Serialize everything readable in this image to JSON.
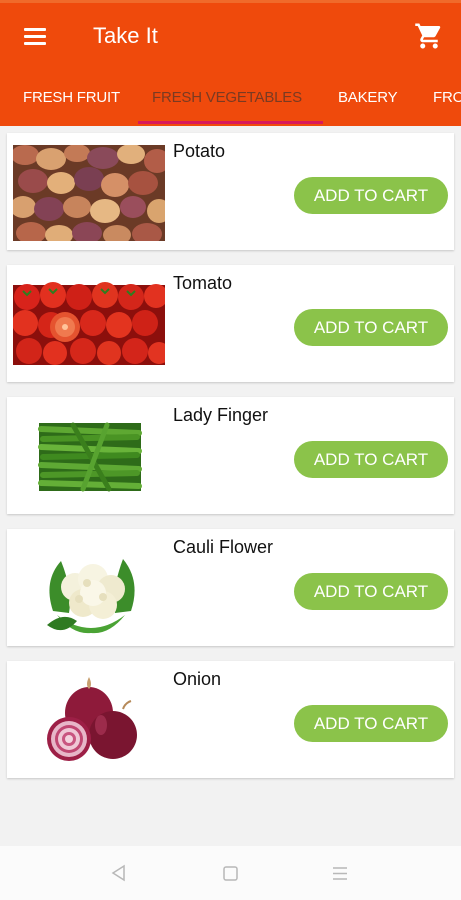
{
  "app": {
    "title": "Take It"
  },
  "tabs": [
    {
      "label": "FRESH FRUIT",
      "active": false
    },
    {
      "label": "FRESH VEGETABLES",
      "active": true
    },
    {
      "label": "BAKERY",
      "active": false
    },
    {
      "label": "FRO",
      "active": false
    }
  ],
  "products": [
    {
      "name": "Potato",
      "button": "ADD TO CART",
      "image": "potato-image"
    },
    {
      "name": "Tomato",
      "button": "ADD TO CART",
      "image": "tomato-image"
    },
    {
      "name": "Lady Finger",
      "button": "ADD TO CART",
      "image": "lady-finger-image"
    },
    {
      "name": "Cauli Flower",
      "button": "ADD TO CART",
      "image": "cauliflower-image"
    },
    {
      "name": "Onion",
      "button": "ADD TO CART",
      "image": "onion-image"
    }
  ],
  "icons": {
    "menu": "menu-icon",
    "cart": "shopping-cart-icon",
    "back": "back-icon",
    "home": "home-icon",
    "recents": "recents-icon"
  },
  "colors": {
    "appbar": "#ef4a0c",
    "button": "#8bc34a",
    "tab_indicator": "#d8195a"
  }
}
